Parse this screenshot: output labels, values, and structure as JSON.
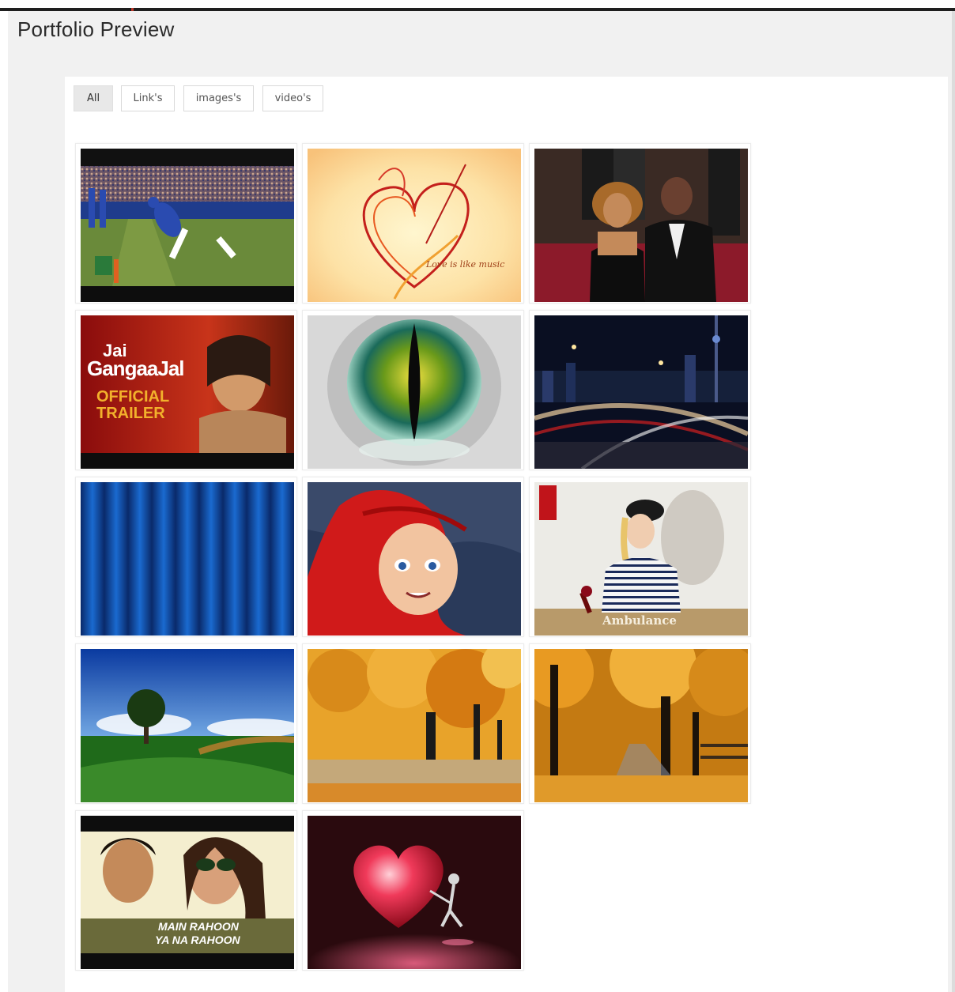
{
  "page": {
    "title": "Portfolio Preview"
  },
  "filters": [
    {
      "label": "All",
      "active": true
    },
    {
      "label": "Link's",
      "active": false
    },
    {
      "label": "images's",
      "active": false
    },
    {
      "label": "video's",
      "active": false
    }
  ],
  "tiles": [
    {
      "subject": "football-catch",
      "overlay": ""
    },
    {
      "subject": "heart-sketch",
      "overlay": "Love is like music"
    },
    {
      "subject": "red-carpet-couple",
      "overlay": ""
    },
    {
      "subject": "movie-trailer-poster",
      "overlay_lines": [
        "Jai",
        "GangaaJal",
        "OFFICIAL",
        "TRAILER"
      ]
    },
    {
      "subject": "dragon-eye",
      "overlay": ""
    },
    {
      "subject": "city-night-highway",
      "overlay": ""
    },
    {
      "subject": "blue-curtain",
      "overlay": ""
    },
    {
      "subject": "cartoon-mermaid",
      "overlay": ""
    },
    {
      "subject": "woman-striped-shirt",
      "overlay": "Ambulance"
    },
    {
      "subject": "lone-tree-field",
      "overlay": ""
    },
    {
      "subject": "autumn-trees",
      "overlay": ""
    },
    {
      "subject": "autumn-path",
      "overlay": ""
    },
    {
      "subject": "music-video-couple",
      "overlay_lines": [
        "MAIN RAHOON",
        "YA NA RAHOON"
      ]
    },
    {
      "subject": "red-heart-figure",
      "overlay": ""
    }
  ],
  "colors": {
    "background": "#f1f1f1",
    "panel": "#ffffff",
    "active_filter": "#e8e8e8",
    "title_text": "#2b2b2b"
  }
}
